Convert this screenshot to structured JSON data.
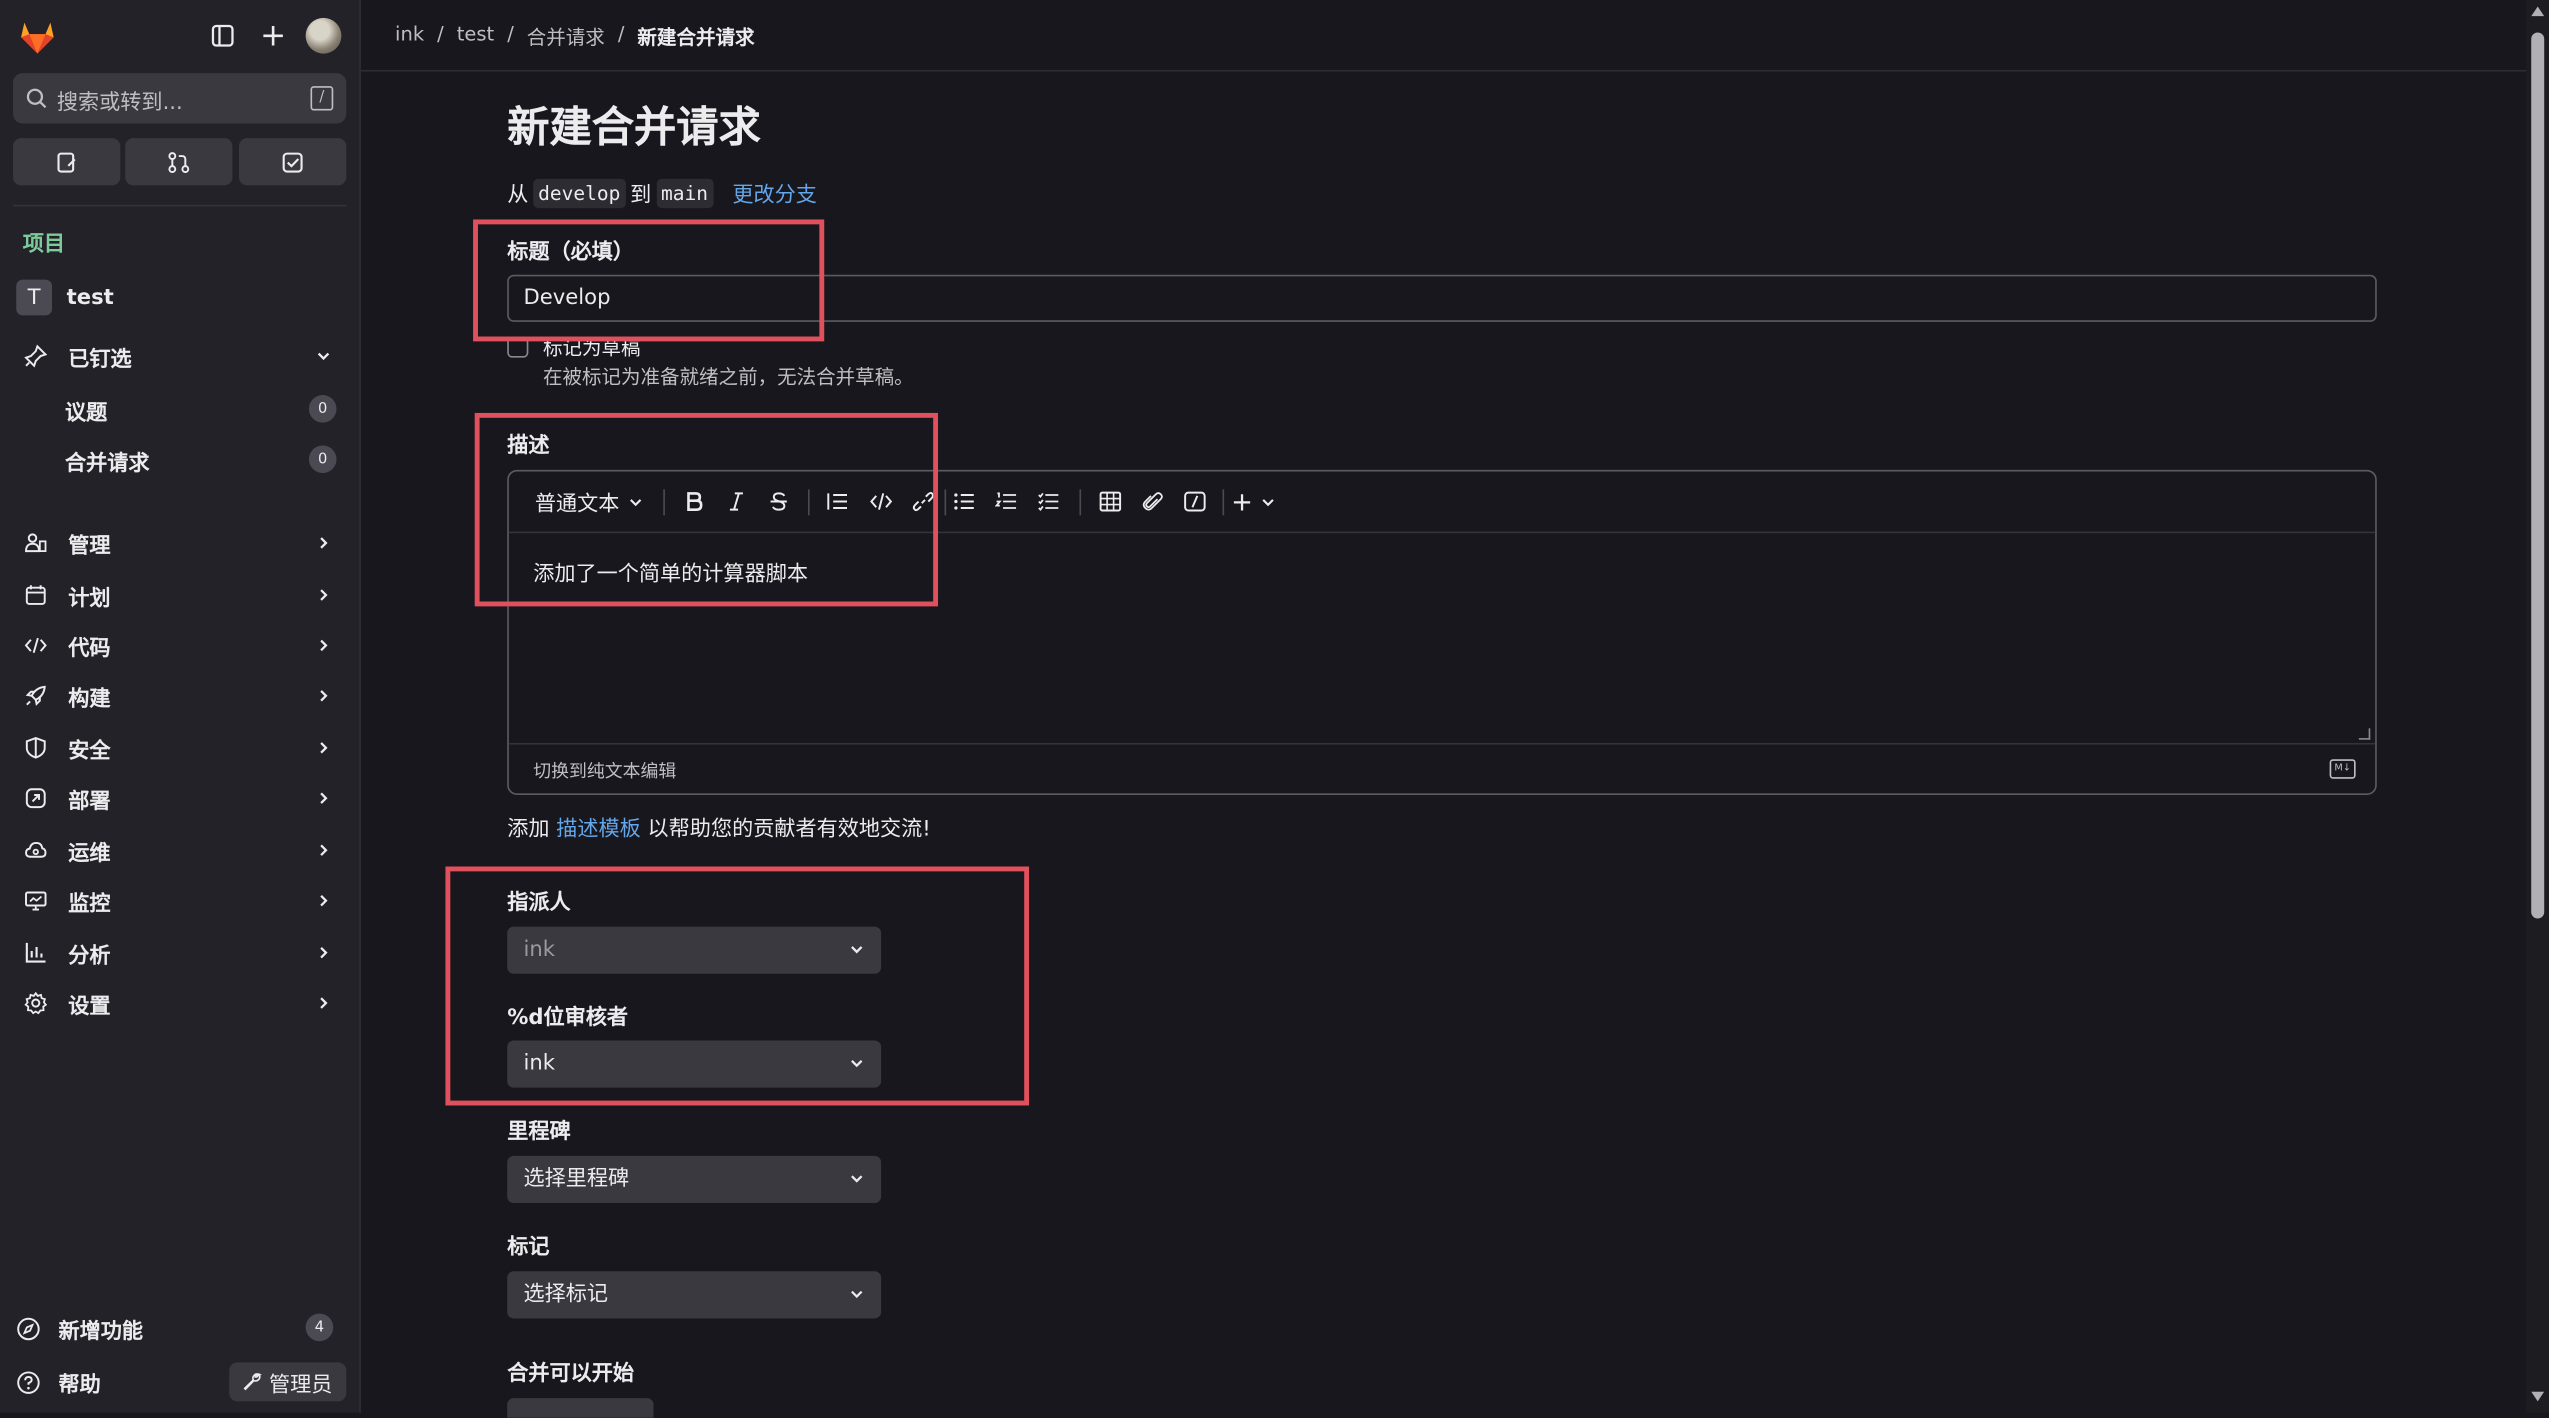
{
  "sidebar": {
    "search_placeholder": "搜索或转到...",
    "search_shortcut": "/",
    "section_title": "项目",
    "project_initial": "T",
    "project_name": "test",
    "pinned": {
      "label": "已钉选",
      "items": [
        {
          "label": "议题",
          "count": "0"
        },
        {
          "label": "合并请求",
          "count": "0"
        }
      ]
    },
    "nav": [
      {
        "label": "管理",
        "icon": "users-icon"
      },
      {
        "label": "计划",
        "icon": "calendar-icon"
      },
      {
        "label": "代码",
        "icon": "code-icon"
      },
      {
        "label": "构建",
        "icon": "rocket-icon"
      },
      {
        "label": "安全",
        "icon": "shield-icon"
      },
      {
        "label": "部署",
        "icon": "deploy-icon"
      },
      {
        "label": "运维",
        "icon": "cloud-icon"
      },
      {
        "label": "监控",
        "icon": "monitor-icon"
      },
      {
        "label": "分析",
        "icon": "chart-icon"
      },
      {
        "label": "设置",
        "icon": "gear-icon"
      }
    ],
    "whats_new": {
      "label": "新增功能",
      "count": "4"
    },
    "help": "帮助",
    "admin": "管理员"
  },
  "breadcrumb": {
    "items": [
      "ink",
      "test",
      "合并请求"
    ],
    "current": "新建合并请求",
    "separator": "/"
  },
  "page": {
    "title": "新建合并请求",
    "from_word": "从",
    "source_branch": "develop",
    "to_word": "到",
    "target_branch": "main",
    "change_branches": "更改分支"
  },
  "form": {
    "title_label": "标题（必填）",
    "title_value": "Develop",
    "draft_label": "标记为草稿",
    "draft_help": "在被标记为准备就绪之前，无法合并草稿。",
    "description_label": "描述",
    "text_style": "普通文本",
    "description_value": "添加了一个简单的计算器脚本",
    "switch_editor": "切换到纯文本编辑",
    "markdown_badge": "M↓",
    "template_prefix": "添加",
    "template_link": "描述模板",
    "template_suffix": "以帮助您的贡献者有效地交流!",
    "assignee_label": "指派人",
    "assignee_value": "ink",
    "reviewer_label": "%d位审核者",
    "reviewer_value": "ink",
    "milestone_label": "里程碑",
    "milestone_value": "选择里程碑",
    "labels_label": "标记",
    "labels_value": "选择标记",
    "merge_after_label": "合并可以开始"
  },
  "colors": {
    "accent_green": "#7dcb9a",
    "link_blue": "#63a6e9",
    "highlight_red": "#e0505d",
    "brand_orange": "#e24329"
  }
}
